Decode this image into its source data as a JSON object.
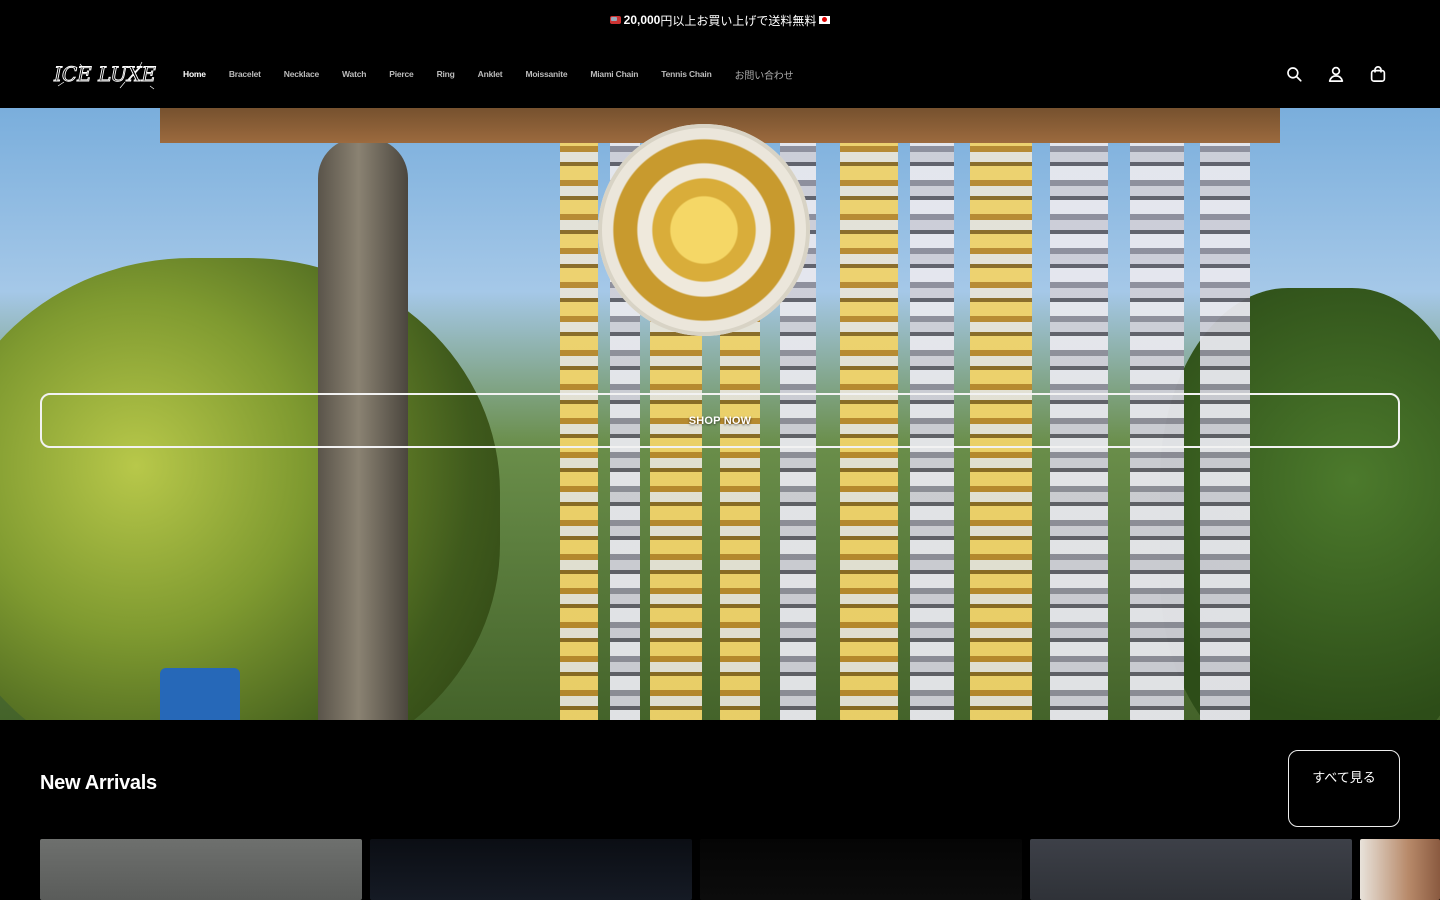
{
  "announcement": {
    "amount": "20,000",
    "text": "円以上お買い上げで送料無料"
  },
  "header": {
    "logo_text": "ICE LUXE",
    "nav": [
      {
        "label": "Home",
        "active": true
      },
      {
        "label": "Bracelet"
      },
      {
        "label": "Necklace"
      },
      {
        "label": "Watch"
      },
      {
        "label": "Pierce"
      },
      {
        "label": "Ring"
      },
      {
        "label": "Anklet"
      },
      {
        "label": "Moissanite"
      },
      {
        "label": "Miami Chain"
      },
      {
        "label": "Tennis Chain"
      },
      {
        "label": "お問い合わせ"
      }
    ],
    "icons": [
      "search-icon",
      "account-icon",
      "cart-icon"
    ]
  },
  "hero": {
    "cta_label": "SHOP NOW"
  },
  "new_arrivals": {
    "title": "New Arrivals",
    "view_all_label": "すべて見る"
  },
  "colors": {
    "background": "#000000",
    "text": "#ffffff"
  }
}
